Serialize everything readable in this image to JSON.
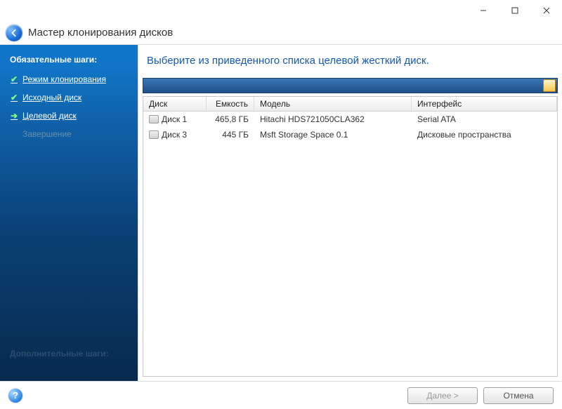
{
  "window": {
    "title": "Мастер клонирования дисков"
  },
  "sidebar": {
    "heading_required": "Обязательные шаги:",
    "heading_optional": "Дополнительные шаги:",
    "steps": [
      {
        "label": "Режим клонирования",
        "state": "done"
      },
      {
        "label": "Исходный диск",
        "state": "done"
      },
      {
        "label": "Целевой диск",
        "state": "current"
      },
      {
        "label": "Завершение",
        "state": "pending"
      }
    ]
  },
  "main": {
    "instruction": "Выберите из приведенного списка целевой жесткий диск.",
    "columns": {
      "disk": "Диск",
      "capacity": "Емкость",
      "model": "Модель",
      "interface": "Интерфейс"
    },
    "rows": [
      {
        "disk": "Диск 1",
        "capacity": "465,8 ГБ",
        "model": "Hitachi HDS721050CLA362",
        "interface": "Serial ATA"
      },
      {
        "disk": "Диск 3",
        "capacity": "445 ГБ",
        "model": "Msft Storage Space 0.1",
        "interface": "Дисковые пространства"
      }
    ]
  },
  "footer": {
    "next": "Далее >",
    "cancel": "Отмена"
  }
}
